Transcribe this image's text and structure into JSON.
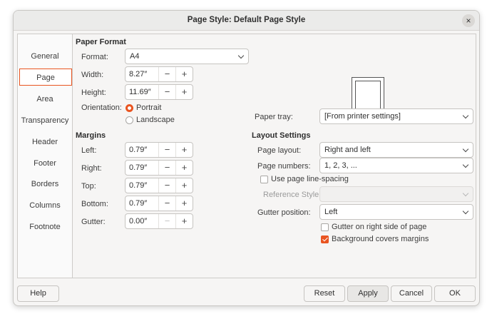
{
  "window": {
    "title": "Page Style: Default Page Style",
    "close_icon": "×"
  },
  "sidebar": {
    "items": [
      {
        "label": "General",
        "active": false
      },
      {
        "label": "Page",
        "active": true
      },
      {
        "label": "Area",
        "active": false
      },
      {
        "label": "Transparency",
        "active": false
      },
      {
        "label": "Header",
        "active": false
      },
      {
        "label": "Footer",
        "active": false
      },
      {
        "label": "Borders",
        "active": false
      },
      {
        "label": "Columns",
        "active": false
      },
      {
        "label": "Footnote",
        "active": false
      }
    ]
  },
  "paper_format": {
    "heading": "Paper Format",
    "format_label": "Format:",
    "format_value": "A4",
    "width_label": "Width:",
    "width_value": "8.27″",
    "height_label": "Height:",
    "height_value": "11.69″",
    "orientation_label": "Orientation:",
    "portrait_label": "Portrait",
    "landscape_label": "Landscape",
    "orientation_selected": "Portrait",
    "paper_tray_label": "Paper tray:",
    "paper_tray_value": "[From printer settings]"
  },
  "margins": {
    "heading": "Margins",
    "left_label": "Left:",
    "left_value": "0.79″",
    "right_label": "Right:",
    "right_value": "0.79″",
    "top_label": "Top:",
    "top_value": "0.79″",
    "bottom_label": "Bottom:",
    "bottom_value": "0.79″",
    "gutter_label": "Gutter:",
    "gutter_value": "0.00″"
  },
  "layout_settings": {
    "heading": "Layout Settings",
    "page_layout_label": "Page layout:",
    "page_layout_value": "Right and left",
    "page_numbers_label": "Page numbers:",
    "page_numbers_value": "1, 2, 3, ...",
    "use_line_spacing_label": "Use page line-spacing",
    "use_line_spacing_checked": false,
    "reference_style_label": "Reference Style:",
    "reference_style_value": "",
    "gutter_position_label": "Gutter position:",
    "gutter_position_value": "Left",
    "gutter_right_label": "Gutter on right side of page",
    "gutter_right_checked": false,
    "bg_covers_label": "Background covers margins",
    "bg_covers_checked": true
  },
  "spin_controls": {
    "minus": "−",
    "plus": "+"
  },
  "buttons": {
    "help": "Help",
    "reset": "Reset",
    "apply": "Apply",
    "cancel": "Cancel",
    "ok": "OK"
  },
  "colors": {
    "accent": "#e95420",
    "window_bg": "#f6f5f4"
  }
}
